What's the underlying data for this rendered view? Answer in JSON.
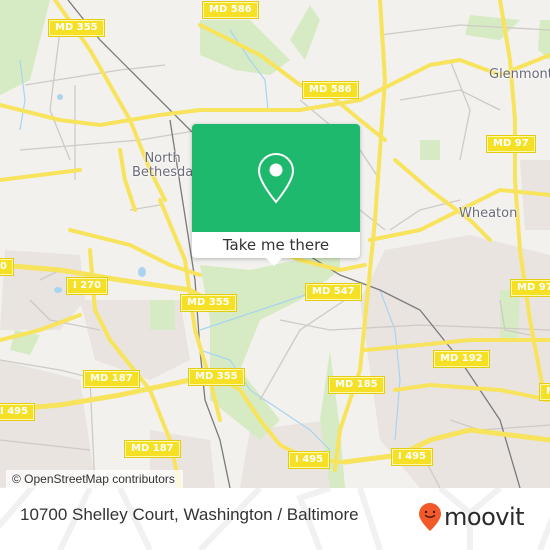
{
  "map": {
    "attribution": "© OpenStreetMap contributors",
    "colors": {
      "background": "#f2f1ee",
      "road": "#f7e35c",
      "road_label_bg": "#f5e026",
      "park": "#d6ebc4",
      "residential": "#e9e4e0",
      "water": "#a8d4ef",
      "minor_road": "#c8c4c0",
      "rail": "#777777"
    },
    "place_labels": [
      {
        "id": "north-bethesda",
        "text": "North\nBethesda"
      },
      {
        "id": "glenmont",
        "text": "Glenmont"
      },
      {
        "id": "wheaton",
        "text": "Wheaton"
      }
    ],
    "road_labels": [
      {
        "id": "md355-top",
        "text": "MD 355"
      },
      {
        "id": "md586-top",
        "text": "MD 586"
      },
      {
        "id": "md586-mid",
        "text": "MD 586"
      },
      {
        "id": "md97-top",
        "text": "MD 97"
      },
      {
        "id": "md97-right",
        "text": "MD 97"
      },
      {
        "id": "i270-left",
        "text": "0"
      },
      {
        "id": "i270",
        "text": "I 270"
      },
      {
        "id": "md355-mid",
        "text": "MD 355"
      },
      {
        "id": "md547",
        "text": "MD 547"
      },
      {
        "id": "md187-upper",
        "text": "MD 187"
      },
      {
        "id": "md355-low",
        "text": "MD 355"
      },
      {
        "id": "md192",
        "text": "MD 192"
      },
      {
        "id": "md185",
        "text": "MD 185"
      },
      {
        "id": "i495-left",
        "text": "I 495"
      },
      {
        "id": "md187-lower",
        "text": "MD 187"
      },
      {
        "id": "i495-mid",
        "text": "I 495"
      },
      {
        "id": "i495-right",
        "text": "I 495"
      },
      {
        "id": "md-right-edge",
        "text": "M"
      }
    ]
  },
  "popup": {
    "icon": "map-pin-icon",
    "cta_label": "Take me there",
    "accent": "#1eb96c"
  },
  "footer": {
    "address": "10700 Shelley Court, Washington / Baltimore",
    "brand": "moovit",
    "brand_icon": "moovit-smiley-pin-icon",
    "brand_color": "#f1592a"
  }
}
